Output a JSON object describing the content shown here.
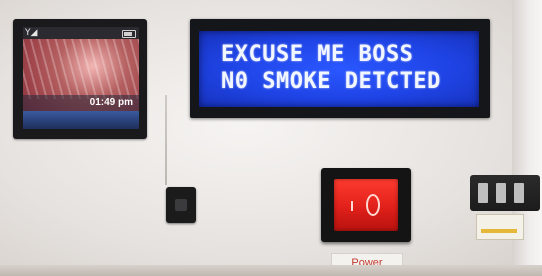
{
  "phone": {
    "time": "01:49 pm",
    "signal_icon": "signal-icon",
    "battery_icon": "battery-icon"
  },
  "lcd": {
    "line1": "EXCUSE ME BOSS",
    "line2": "N0 SMOKE DETCTED",
    "backlight_color": "#2a57ff"
  },
  "power_switch": {
    "label": "Power",
    "rocker_color": "#e0201a"
  }
}
